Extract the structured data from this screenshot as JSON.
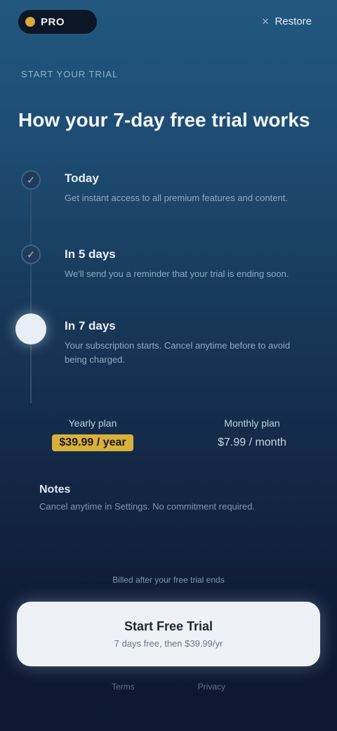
{
  "header": {
    "logo_text": "PRO",
    "restore_label": "Restore",
    "close_symbol": "✕"
  },
  "eyebrow": "START YOUR TRIAL",
  "headline": "How your 7-day free trial works",
  "steps": [
    {
      "title": "Today",
      "desc": "Get instant access to all premium features and content."
    },
    {
      "title": "In 5 days",
      "desc": "We'll send you a reminder that your trial is ending soon."
    },
    {
      "title": "In 7 days",
      "desc": "Your subscription starts. Cancel anytime before to avoid being charged."
    }
  ],
  "plans": {
    "left_name": "Yearly plan",
    "left_price": "$39.99 / year",
    "right_name": "Monthly plan",
    "right_price": "$7.99 / month"
  },
  "note": {
    "title": "Notes",
    "body": "Cancel anytime in Settings. No commitment required."
  },
  "legal": "Billed after your free trial ends",
  "cta": {
    "label": "Start Free Trial",
    "sub": "7 days free, then $39.99/yr"
  },
  "footer": {
    "terms": "Terms",
    "privacy": "Privacy"
  },
  "colors": {
    "accent": "#d8b03c",
    "background_top": "#22587f",
    "background_bottom": "#0d1730"
  },
  "icons": {
    "step_done": "check-icon",
    "step_active": "bell-icon"
  }
}
